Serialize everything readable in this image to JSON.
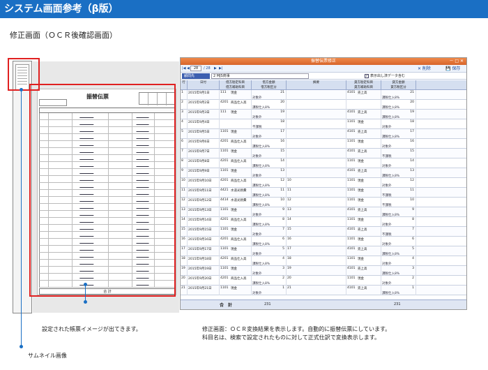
{
  "banner": {
    "title": "システム画面参考（β版）"
  },
  "subtitle": "修正画面（ＯＣＲ後確認画面）",
  "voucher": {
    "title": "振替伝票",
    "footer": "合 計"
  },
  "window": {
    "title": "振替伝票修正",
    "controls": "－ □ ✕",
    "nav": {
      "first": "|◀",
      "prev": "◀",
      "page": "28",
      "of": "/ 28",
      "next": "▶",
      "last": "▶|",
      "delete": "✕ 削除",
      "save": "💾 保存"
    },
    "info": {
      "label": "顧問先",
      "value": "2 MJS商事",
      "checkbox": "✓",
      "checkbox_label": "表示出し済データ含む"
    },
    "columns": [
      {
        "top": "行",
        "bottom": ""
      },
      {
        "top": "日付",
        "bottom": ""
      },
      {
        "top": "借方勘定科目",
        "bottom": "借方補助科目"
      },
      {
        "top": "借方金額",
        "bottom": "借方税区分"
      },
      {
        "top": "摘要",
        "bottom": ""
      },
      {
        "top": "貸方勘定科目",
        "bottom": "貸方補助科目"
      },
      {
        "top": "貸方金額",
        "bottom": "貸方税区分"
      }
    ],
    "rows": [
      {
        "no": "1",
        "date": "2015年9月1日",
        "dcode": "111",
        "dacct": "現金",
        "dsub": "",
        "damt": "21",
        "dtax": "対象外",
        "memo": "",
        "ccode": "4101",
        "cacct": "売上高",
        "csub": "",
        "camt": "21",
        "ctax": "課税仕入8%"
      },
      {
        "no": "2",
        "date": "2015年9月2日",
        "dcode": "4201",
        "dacct": "商品仕入高",
        "dsub": "",
        "damt": "20",
        "dtax": "課税仕入8%",
        "memo": "",
        "ccode": "",
        "cacct": "",
        "csub": "",
        "camt": "20",
        "ctax": "課税仕入8%"
      },
      {
        "no": "3",
        "date": "2015年9月3日",
        "dcode": "111",
        "dacct": "現金",
        "dsub": "",
        "damt": "19",
        "dtax": "対象外",
        "memo": "",
        "ccode": "4101",
        "cacct": "売上高",
        "csub": "",
        "camt": "19",
        "ctax": "課税仕入8%"
      },
      {
        "no": "4",
        "date": "2015年9月4日",
        "dcode": "",
        "dacct": "",
        "dsub": "",
        "damt": "18",
        "dtax": "不課税",
        "memo": "",
        "ccode": "1101",
        "cacct": "現金",
        "csub": "",
        "camt": "18",
        "ctax": "対象外"
      },
      {
        "no": "5",
        "date": "2015年9月5日",
        "dcode": "1101",
        "dacct": "現金",
        "dsub": "",
        "damt": "17",
        "dtax": "対象外",
        "memo": "",
        "ccode": "4101",
        "cacct": "売上高",
        "csub": "",
        "camt": "17",
        "ctax": "課税仕入8%"
      },
      {
        "no": "6",
        "date": "2015年9月6日",
        "dcode": "4201",
        "dacct": "商品仕入高",
        "dsub": "",
        "damt": "16",
        "dtax": "課税仕入8%",
        "memo": "",
        "ccode": "1101",
        "cacct": "現金",
        "csub": "",
        "camt": "16",
        "ctax": "対象外"
      },
      {
        "no": "7",
        "date": "2015年9月7日",
        "dcode": "1101",
        "dacct": "現金",
        "dsub": "",
        "damt": "15",
        "dtax": "対象外",
        "memo": "",
        "ccode": "4101",
        "cacct": "売上高",
        "csub": "",
        "camt": "15",
        "ctax": "不課税"
      },
      {
        "no": "8",
        "date": "2015年9月8日",
        "dcode": "4201",
        "dacct": "商品仕入高",
        "dsub": "",
        "damt": "14",
        "dtax": "課税仕入8%",
        "memo": "",
        "ccode": "1101",
        "cacct": "現金",
        "csub": "",
        "camt": "14",
        "ctax": "対象外"
      },
      {
        "no": "9",
        "date": "2015年9月9日",
        "dcode": "1101",
        "dacct": "現金",
        "dsub": "",
        "damt": "13",
        "dtax": "対象外",
        "memo": "",
        "ccode": "4101",
        "cacct": "売上高",
        "csub": "",
        "camt": "13",
        "ctax": "課税仕入8%"
      },
      {
        "no": "10",
        "date": "2015年9月10日",
        "dcode": "4201",
        "dacct": "商品仕入高",
        "dsub": "",
        "damt": "12",
        "dtax": "課税仕入8%",
        "memo": "10",
        "ccode": "1101",
        "cacct": "現金",
        "csub": "",
        "camt": "12",
        "ctax": "対象外"
      },
      {
        "no": "11",
        "date": "2015年9月11日",
        "dcode": "4421",
        "dacct": "水道光熱費",
        "dsub": "",
        "damt": "11",
        "dtax": "課税仕入8%",
        "memo": "11",
        "ccode": "1101",
        "cacct": "現金",
        "csub": "",
        "camt": "11",
        "ctax": "不課税"
      },
      {
        "no": "12",
        "date": "2015年9月12日",
        "dcode": "4414",
        "dacct": "水道光熱費",
        "dsub": "",
        "damt": "10",
        "dtax": "課税仕入8%",
        "memo": "12",
        "ccode": "1101",
        "cacct": "現金",
        "csub": "",
        "camt": "10",
        "ctax": "不課税"
      },
      {
        "no": "13",
        "date": "2015年9月13日",
        "dcode": "1101",
        "dacct": "現金",
        "dsub": "",
        "damt": "9",
        "dtax": "対象外",
        "memo": "13",
        "ccode": "4101",
        "cacct": "売上高",
        "csub": "",
        "camt": "9",
        "ctax": "課税仕入8%"
      },
      {
        "no": "14",
        "date": "2015年9月14日",
        "dcode": "4201",
        "dacct": "商品仕入高",
        "dsub": "",
        "damt": "8",
        "dtax": "課税仕入8%",
        "memo": "14",
        "ccode": "1101",
        "cacct": "現金",
        "csub": "",
        "camt": "8",
        "ctax": "対象外"
      },
      {
        "no": "15",
        "date": "2015年9月15日",
        "dcode": "1101",
        "dacct": "現金",
        "dsub": "",
        "damt": "7",
        "dtax": "対象外",
        "memo": "15",
        "ccode": "4101",
        "cacct": "売上高",
        "csub": "",
        "camt": "7",
        "ctax": "不課税"
      },
      {
        "no": "16",
        "date": "2015年9月16日",
        "dcode": "4201",
        "dacct": "商品仕入高",
        "dsub": "",
        "damt": "6",
        "dtax": "課税仕入8%",
        "memo": "16",
        "ccode": "1101",
        "cacct": "現金",
        "csub": "",
        "camt": "6",
        "ctax": "対象外"
      },
      {
        "no": "17",
        "date": "2015年9月17日",
        "dcode": "1101",
        "dacct": "現金",
        "dsub": "",
        "damt": "5",
        "dtax": "対象外",
        "memo": "17",
        "ccode": "4101",
        "cacct": "売上高",
        "csub": "",
        "camt": "5",
        "ctax": "課税仕入8%"
      },
      {
        "no": "18",
        "date": "2015年9月18日",
        "dcode": "4201",
        "dacct": "商品仕入高",
        "dsub": "",
        "damt": "4",
        "dtax": "課税仕入8%",
        "memo": "18",
        "ccode": "1101",
        "cacct": "現金",
        "csub": "",
        "camt": "4",
        "ctax": "対象外"
      },
      {
        "no": "19",
        "date": "2015年9月19日",
        "dcode": "1101",
        "dacct": "現金",
        "dsub": "",
        "damt": "3",
        "dtax": "対象外",
        "memo": "19",
        "ccode": "4101",
        "cacct": "売上高",
        "csub": "",
        "camt": "3",
        "ctax": "課税仕入8%"
      },
      {
        "no": "20",
        "date": "2015年9月20日",
        "dcode": "4201",
        "dacct": "商品仕入高",
        "dsub": "",
        "damt": "2",
        "dtax": "課税仕入8%",
        "memo": "20",
        "ccode": "1101",
        "cacct": "現金",
        "csub": "",
        "camt": "2",
        "ctax": "対象外"
      },
      {
        "no": "21",
        "date": "2015年9月21日",
        "dcode": "1101",
        "dacct": "現金",
        "dsub": "",
        "damt": "1",
        "dtax": "対象外",
        "memo": "21",
        "ccode": "4101",
        "cacct": "売上高",
        "csub": "",
        "camt": "1",
        "ctax": "課税仕入8%"
      }
    ],
    "total": {
      "label": "合　計",
      "debit": "231",
      "credit": "231"
    }
  },
  "captions": {
    "image": "設定された帳票イメージが出てきます。",
    "edit_line1": "修正画面：ＯＣＲ変換結果を表示します。自動的に振替伝票にしています。",
    "edit_line2": "科目名は、検索で設定されたものに対して正式仕訳で変換表示します。",
    "thumbnail": "サムネイル画像"
  },
  "colors": {
    "accent": "#1a6fc4",
    "highlight": "#e02020",
    "titlebar": "#e0743a"
  }
}
